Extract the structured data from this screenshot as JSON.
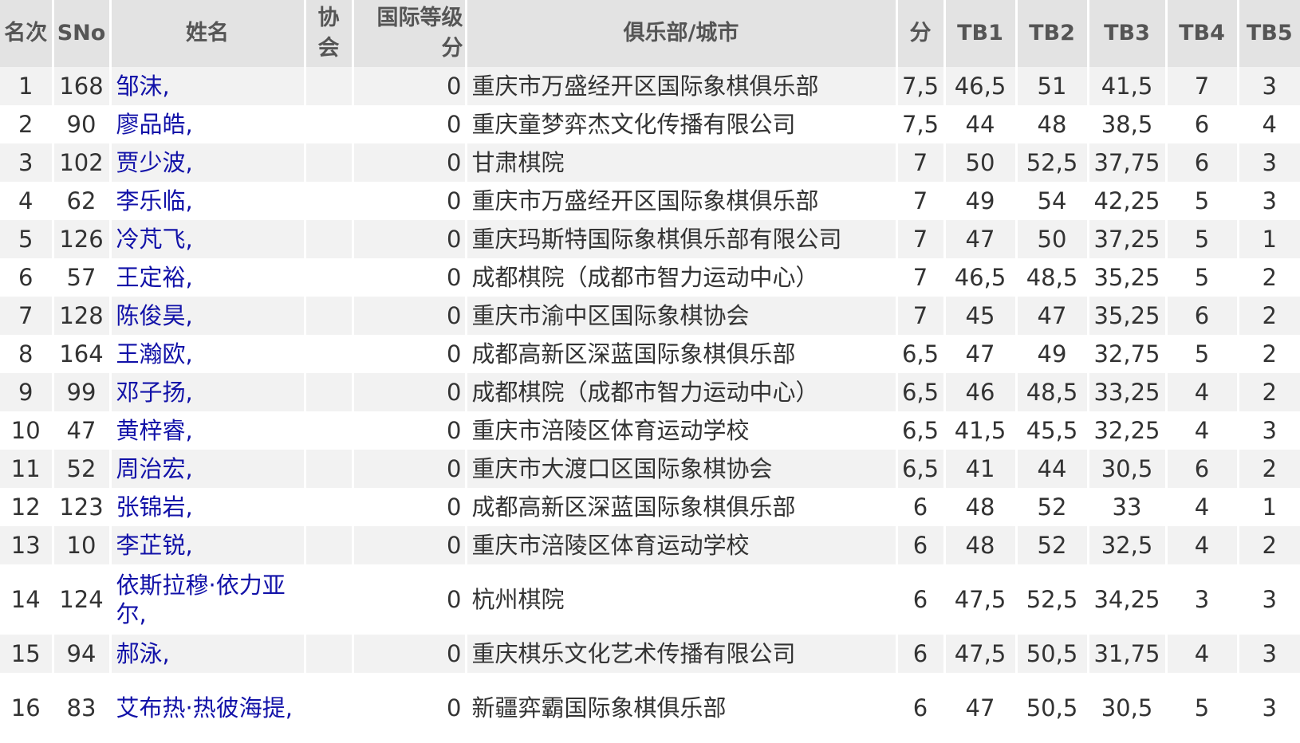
{
  "table": {
    "headers": {
      "rank": "名次",
      "sno": "SNo",
      "name": "姓名",
      "fed_line1": "协",
      "fed_line2": "会",
      "rating_line1": "国际等级",
      "rating_line2": "分",
      "club": "俱乐部/城市",
      "points": "分",
      "tb1": "TB1",
      "tb2": "TB2",
      "tb3": "TB3",
      "tb4": "TB4",
      "tb5": "TB5"
    },
    "rows": [
      {
        "rank": "1",
        "sno": "168",
        "name": "邹沫,",
        "fed": "",
        "rating": "0",
        "club": "重庆市万盛经开区国际象棋俱乐部",
        "pts": "7,5",
        "tb1": "46,5",
        "tb2": "51",
        "tb3": "41,5",
        "tb4": "7",
        "tb5": "3"
      },
      {
        "rank": "2",
        "sno": "90",
        "name": "廖品皓,",
        "fed": "",
        "rating": "0",
        "club": "重庆童梦弈杰文化传播有限公司",
        "pts": "7,5",
        "tb1": "44",
        "tb2": "48",
        "tb3": "38,5",
        "tb4": "6",
        "tb5": "4"
      },
      {
        "rank": "3",
        "sno": "102",
        "name": "贾少波,",
        "fed": "",
        "rating": "0",
        "club": "甘肃棋院",
        "pts": "7",
        "tb1": "50",
        "tb2": "52,5",
        "tb3": "37,75",
        "tb4": "6",
        "tb5": "3"
      },
      {
        "rank": "4",
        "sno": "62",
        "name": "李乐临,",
        "fed": "",
        "rating": "0",
        "club": "重庆市万盛经开区国际象棋俱乐部",
        "pts": "7",
        "tb1": "49",
        "tb2": "54",
        "tb3": "42,25",
        "tb4": "5",
        "tb5": "3"
      },
      {
        "rank": "5",
        "sno": "126",
        "name": "冷芃飞,",
        "fed": "",
        "rating": "0",
        "club": "重庆玛斯特国际象棋俱乐部有限公司",
        "pts": "7",
        "tb1": "47",
        "tb2": "50",
        "tb3": "37,25",
        "tb4": "5",
        "tb5": "1"
      },
      {
        "rank": "6",
        "sno": "57",
        "name": "王定裕,",
        "fed": "",
        "rating": "0",
        "club": "成都棋院（成都市智力运动中心）",
        "pts": "7",
        "tb1": "46,5",
        "tb2": "48,5",
        "tb3": "35,25",
        "tb4": "5",
        "tb5": "2"
      },
      {
        "rank": "7",
        "sno": "128",
        "name": "陈俊昊,",
        "fed": "",
        "rating": "0",
        "club": "重庆市渝中区国际象棋协会",
        "pts": "7",
        "tb1": "45",
        "tb2": "47",
        "tb3": "35,25",
        "tb4": "6",
        "tb5": "2"
      },
      {
        "rank": "8",
        "sno": "164",
        "name": "王瀚欧,",
        "fed": "",
        "rating": "0",
        "club": "成都高新区深蓝国际象棋俱乐部",
        "pts": "6,5",
        "tb1": "47",
        "tb2": "49",
        "tb3": "32,75",
        "tb4": "5",
        "tb5": "2"
      },
      {
        "rank": "9",
        "sno": "99",
        "name": "邓子扬,",
        "fed": "",
        "rating": "0",
        "club": "成都棋院（成都市智力运动中心）",
        "pts": "6,5",
        "tb1": "46",
        "tb2": "48,5",
        "tb3": "33,25",
        "tb4": "4",
        "tb5": "2"
      },
      {
        "rank": "10",
        "sno": "47",
        "name": "黄梓睿,",
        "fed": "",
        "rating": "0",
        "club": "重庆市涪陵区体育运动学校",
        "pts": "6,5",
        "tb1": "41,5",
        "tb2": "45,5",
        "tb3": "32,25",
        "tb4": "4",
        "tb5": "3"
      },
      {
        "rank": "11",
        "sno": "52",
        "name": "周治宏,",
        "fed": "",
        "rating": "0",
        "club": "重庆市大渡口区国际象棋协会",
        "pts": "6,5",
        "tb1": "41",
        "tb2": "44",
        "tb3": "30,5",
        "tb4": "6",
        "tb5": "2"
      },
      {
        "rank": "12",
        "sno": "123",
        "name": "张锦岩,",
        "fed": "",
        "rating": "0",
        "club": "成都高新区深蓝国际象棋俱乐部",
        "pts": "6",
        "tb1": "48",
        "tb2": "52",
        "tb3": "33",
        "tb4": "4",
        "tb5": "1"
      },
      {
        "rank": "13",
        "sno": "10",
        "name": "李芷锐,",
        "fed": "",
        "rating": "0",
        "club": "重庆市涪陵区体育运动学校",
        "pts": "6",
        "tb1": "48",
        "tb2": "52",
        "tb3": "32,5",
        "tb4": "4",
        "tb5": "2"
      },
      {
        "rank": "14",
        "sno": "124",
        "name": "依斯拉穆·依力亚尔,",
        "fed": "",
        "rating": "0",
        "club": "杭州棋院",
        "pts": "6",
        "tb1": "47,5",
        "tb2": "52,5",
        "tb3": "34,25",
        "tb4": "3",
        "tb5": "3"
      },
      {
        "rank": "15",
        "sno": "94",
        "name": "郝泳,",
        "fed": "",
        "rating": "0",
        "club": "重庆棋乐文化艺术传播有限公司",
        "pts": "6",
        "tb1": "47,5",
        "tb2": "50,5",
        "tb3": "31,75",
        "tb4": "4",
        "tb5": "3"
      },
      {
        "rank": "16",
        "sno": "83",
        "name": "艾布热·热彼海提,",
        "fed": "",
        "rating": "0",
        "club": "新疆弈霸国际象棋俱乐部",
        "pts": "6",
        "tb1": "47",
        "tb2": "50,5",
        "tb3": "30,5",
        "tb4": "5",
        "tb5": "3"
      }
    ]
  }
}
